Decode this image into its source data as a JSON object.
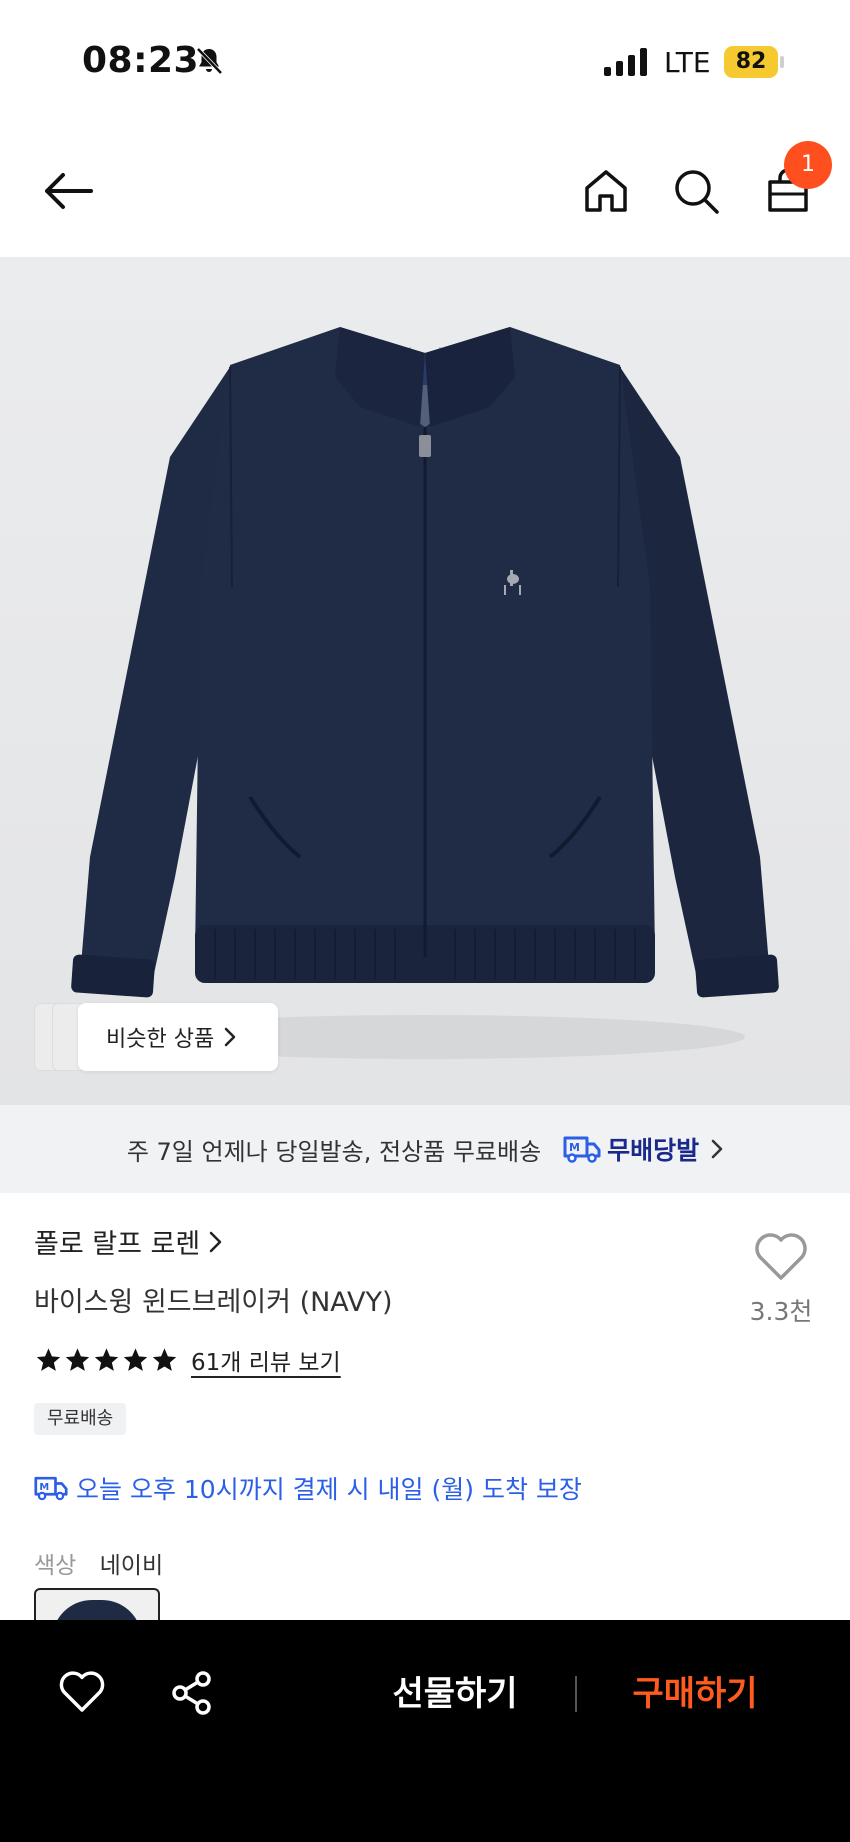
{
  "status_bar": {
    "time": "08:23",
    "network": "LTE",
    "battery": "82"
  },
  "nav": {
    "cart_count": "1"
  },
  "product_image": {
    "similar_label": "비슷한 상품"
  },
  "shipping_banner": {
    "text": "주 7일 언제나 당일발송, 전상품 무료배송",
    "badge": "무배당발"
  },
  "product": {
    "brand": "폴로 랄프 로렌",
    "name": "바이스윙 윈드브레이커 (NAVY)",
    "likes": "3.3천",
    "rating": 5,
    "review_link": "61개 리뷰 보기",
    "free_shipping_badge": "무료배송",
    "delivery_notice": "오늘 오후 10시까지 결제 시 내일 (월) 도착 보장",
    "color_label": "색상",
    "color_value": "네이비"
  },
  "bottom_bar": {
    "gift_label": "선물하기",
    "buy_label": "구매하기"
  },
  "colors": {
    "accent": "#ff4f1f",
    "buy": "#ff5a1f",
    "delivery_blue": "#2c5fe8",
    "badge_navy": "#1a2a8c",
    "jacket_navy": "#1f2a44"
  }
}
